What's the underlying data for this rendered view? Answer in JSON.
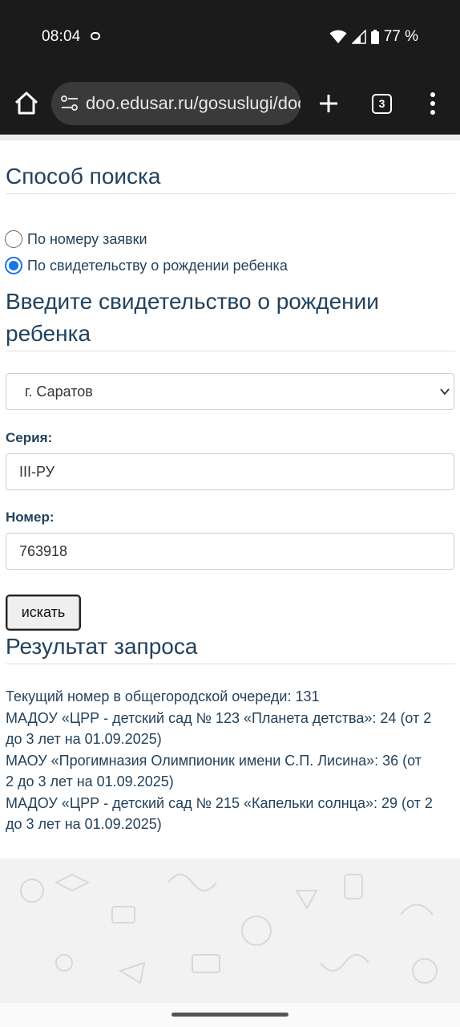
{
  "status_bar": {
    "time": "08:04",
    "battery": "77 %"
  },
  "browser": {
    "url": "doo.edusar.ru/gosuslugi/doo",
    "tab_count": "3"
  },
  "search_method": {
    "title": "Способ поиска",
    "options": [
      {
        "label": "По номеру заявки",
        "selected": false
      },
      {
        "label": "По свидетельству о рождении ребенка",
        "selected": true
      }
    ]
  },
  "certificate": {
    "title_line1": "Введите свидетельство о рождении",
    "title_line2": "ребенка",
    "city": "г. Саратов",
    "series_label": "Серия:",
    "series_value": "III-РУ",
    "number_label": "Номер:",
    "number_value": "763918",
    "search_button": "искать"
  },
  "result": {
    "title": "Результат запроса",
    "lines": [
      "Текущий номер в общегородской очереди: 131",
      "МАДОУ «ЦРР - детский сад № 123 «Планета детства»: 24 (от 2",
      "до 3 лет на 01.09.2025)",
      "МАОУ «Прогимназия Олимпионик имени С.П. Лисина»: 36 (от",
      "2 до 3 лет на 01.09.2025)",
      "МАДОУ «ЦРР - детский сад № 215 «Капельки солнца»: 29 (от 2",
      "до 3 лет на 01.09.2025)"
    ]
  },
  "colors": {
    "heading": "#23425c",
    "radio_accent": "#1a73e8"
  }
}
